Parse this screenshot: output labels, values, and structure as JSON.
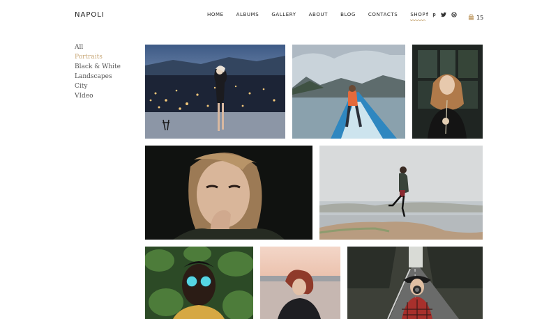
{
  "header": {
    "logo": "NAPOLI",
    "nav": [
      "HOME",
      "ALBUMS",
      "GALLERY",
      "ABOUT",
      "BLOG",
      "CONTACTS",
      "SHOP"
    ],
    "active_nav": "SHOP",
    "social_icons": [
      "facebook-icon",
      "pinterest-icon",
      "twitter-icon",
      "dribbble-icon"
    ],
    "cart_count": "15"
  },
  "filters": [
    "All",
    "Portraits",
    "Black & White",
    "Landscapes",
    "City",
    "VIdeo"
  ],
  "active_filter": "Portraits",
  "colors": {
    "accent": "#c9a97a",
    "text": "#222222",
    "filter_text": "#555555"
  },
  "gallery": [
    {
      "subject": "woman on rooftop overlooking city lights at dusk"
    },
    {
      "subject": "person sitting on bow of blue boat on lake with mountains"
    },
    {
      "subject": "woman holding flower in front of dark window"
    },
    {
      "subject": "close-up portrait of woman with hand to lips"
    },
    {
      "subject": "woman jumping mid-air by the water"
    },
    {
      "subject": "man wearing reflective round sunglasses among foliage"
    },
    {
      "subject": "woman with wind-blown hair by the sea at sunset"
    },
    {
      "subject": "woman in hat with camera on forest road"
    }
  ]
}
